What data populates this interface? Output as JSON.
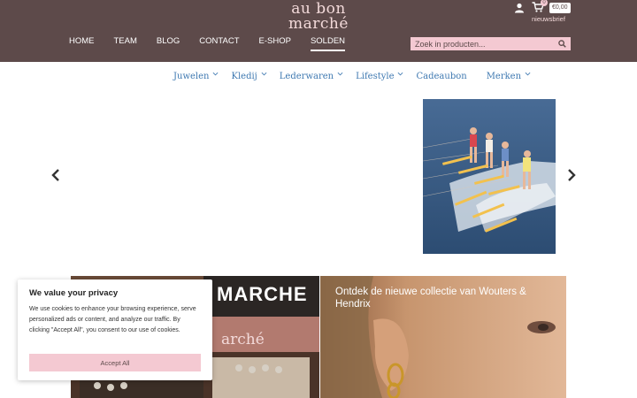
{
  "brand": {
    "logo_line1": "au bon",
    "logo_line2": "marché"
  },
  "main_nav": [
    "HOME",
    "TEAM",
    "BLOG",
    "CONTACT",
    "E-SHOP",
    "SOLDEN"
  ],
  "main_nav_active": "SOLDEN",
  "header": {
    "cart_count": "0",
    "cart_total": "€0,00",
    "newsletter_label": "nieuwsbrief",
    "user_icon": "user-icon",
    "cart_icon": "cart-icon"
  },
  "search": {
    "placeholder": "Zoek in producten...",
    "icon": "search-icon"
  },
  "category_nav": [
    "Juwelen",
    "Kledij",
    "Lederwaren",
    "Lifestyle",
    "Cadeaubon",
    "Merken"
  ],
  "carousel": {
    "prev_icon": "chevron-left-icon",
    "next_icon": "chevron-right-icon"
  },
  "promo_right": {
    "title": "Ontdek de nieuwe collectie van Wouters & Hendrix"
  },
  "promo_left": {
    "sign_text_1": "MARCHE",
    "sign_text_2": "arché"
  },
  "cookie": {
    "title": "We value your privacy",
    "body": "We use cookies to enhance your browsing experience, serve personalized ads or content, and analyze our traffic. By clicking \"Accept All\", you consent to our use of cookies.",
    "accept_label": "Accept All"
  },
  "colors": {
    "header_bg": "#5d4a4a",
    "accent_pink": "#f4c9d2",
    "link_blue": "#3f79b1"
  }
}
